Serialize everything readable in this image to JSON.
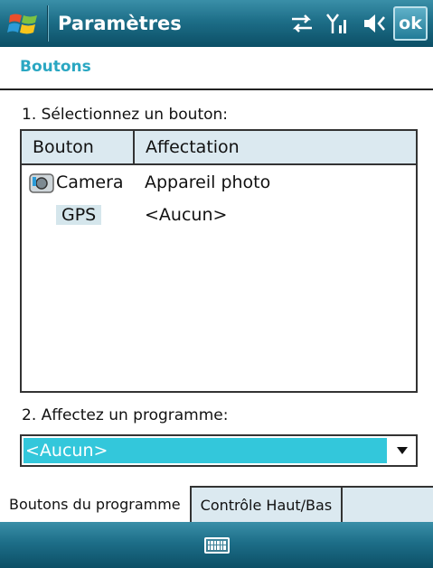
{
  "window": {
    "title": "Paramètres",
    "ok_label": "ok"
  },
  "icons": {
    "start": "windows-flag-icon",
    "connectivity": "sync-arrows-icon",
    "signal": "signal-bars-icon",
    "volume": "speaker-icon",
    "camera": "camera-button-icon",
    "keyboard": "keyboard-icon"
  },
  "section": {
    "title": "Boutons"
  },
  "step1": {
    "label": "1. Sélectionnez un bouton:"
  },
  "listview": {
    "columns": [
      "Bouton",
      "Affectation"
    ],
    "rows": [
      {
        "button": "Camera",
        "assignment": "Appareil photo"
      },
      {
        "button": "GPS",
        "assignment": "<Aucun>"
      }
    ]
  },
  "step2": {
    "label": "2. Affectez un programme:"
  },
  "program_select": {
    "value": "<Aucun>"
  },
  "tabs": [
    "Boutons du programme",
    "Contrôle Haut/Bas"
  ],
  "colors": {
    "accent": "#2aa7c2",
    "selection": "#33c7db",
    "bar": "#1d6e88"
  }
}
